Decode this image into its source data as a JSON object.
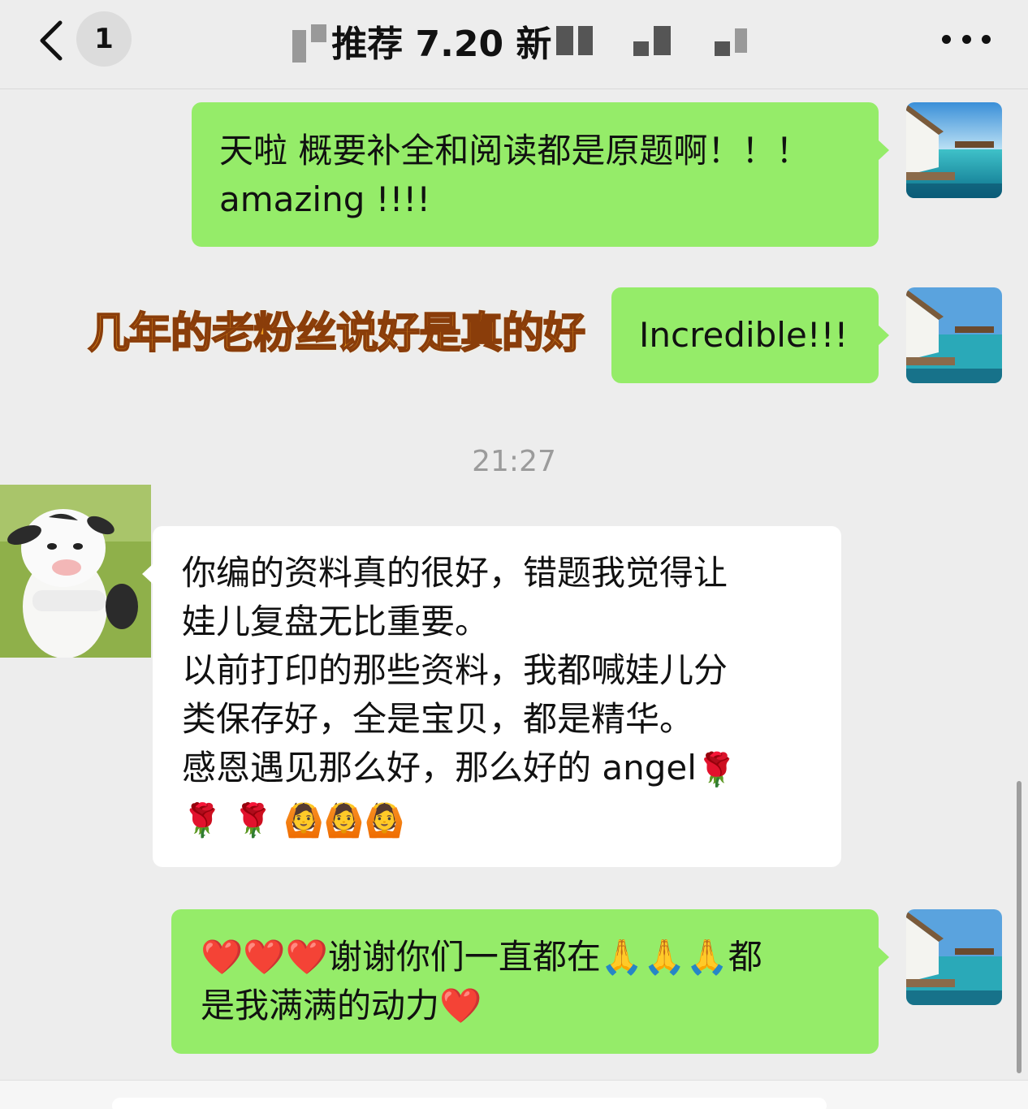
{
  "header": {
    "unread_count": "1",
    "title": "推荐 7.20 新"
  },
  "messages": [
    {
      "id": "m1",
      "side": "me",
      "text": "天啦 概要补全和阅读都是原题啊！！！\namazing !!!!"
    },
    {
      "id": "m2",
      "side": "me",
      "text": "Incredible!!!"
    },
    {
      "id": "m3",
      "side": "other",
      "text": "你编的资料真的很好，错题我觉得让\n娃儿复盘无比重要。\n以前打印的那些资料，我都喊娃儿分\n类保存好，全是宝贝，都是精华。\n感恩遇见那么好，那么好的 angel",
      "trailing_emoji": "🌹",
      "line2_emoji": "🌹 🌹 🙆🙆🙆"
    },
    {
      "id": "m4",
      "side": "me",
      "text": "❤️❤️❤️谢谢你们一直都在🙏🙏🙏都\n是我满满的动力❤️"
    }
  ],
  "timestamp": "21:27",
  "overlay_caption": "几年的老粉丝说好是真的好",
  "colors": {
    "bubble_green": "#95ec69",
    "bubble_white": "#ffffff",
    "background": "#ededed",
    "caption_fill": "#f0a020"
  }
}
